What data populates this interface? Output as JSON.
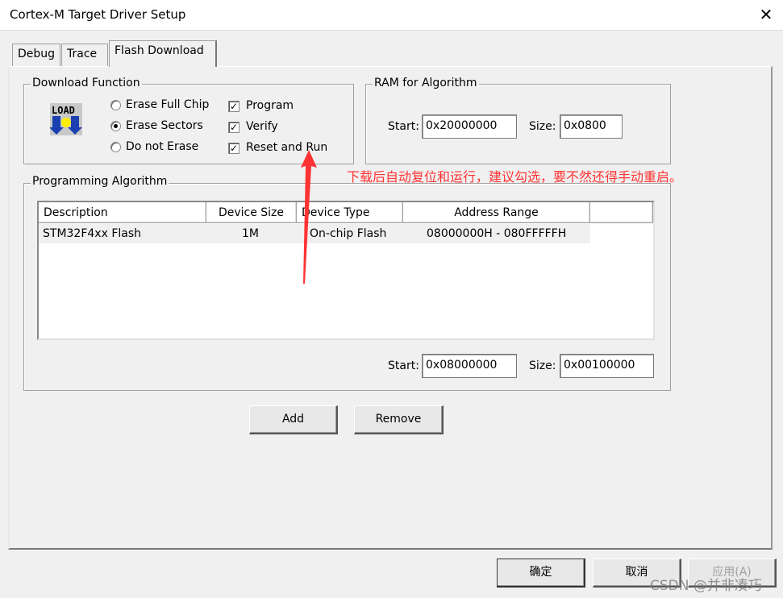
{
  "window": {
    "title": "Cortex-M Target Driver Setup",
    "close_icon": "close-icon"
  },
  "tabs": [
    {
      "label": "Debug"
    },
    {
      "label": "Trace"
    },
    {
      "label": "Flash Download",
      "active": true
    }
  ],
  "download_function": {
    "label": "Download Function",
    "icon": "load-icon",
    "icon_text": "LOAD",
    "erase_options": [
      {
        "label": "Erase Full Chip",
        "selected": false
      },
      {
        "label": "Erase Sectors",
        "selected": true
      },
      {
        "label": "Do not Erase",
        "selected": false
      }
    ],
    "checks": [
      {
        "label": "Program",
        "checked": true
      },
      {
        "label": "Verify",
        "checked": true
      },
      {
        "label": "Reset and Run",
        "checked": true
      }
    ]
  },
  "ram": {
    "label": "RAM for Algorithm",
    "start_label": "Start:",
    "start": "0x20000000",
    "size_label": "Size:",
    "size": "0x0800"
  },
  "programming": {
    "label": "Programming Algorithm",
    "columns": [
      "Description",
      "Device Size",
      "Device Type",
      "Address Range"
    ],
    "rows": [
      [
        "STM32F4xx Flash",
        "1M",
        "On-chip Flash",
        "08000000H - 080FFFFFH"
      ]
    ],
    "start_label": "Start:",
    "start": "0x08000000",
    "size_label": "Size:",
    "size": "0x00100000"
  },
  "buttons": {
    "add": "Add",
    "remove": "Remove",
    "ok": "确定",
    "cancel": "取消",
    "apply": "应用(A)"
  },
  "annotation": {
    "text": "下载后自动复位和运行，建议勾选，要不然还得手动重启。",
    "color": "#ff3333"
  },
  "watermark": "CSDN @并非凑巧"
}
